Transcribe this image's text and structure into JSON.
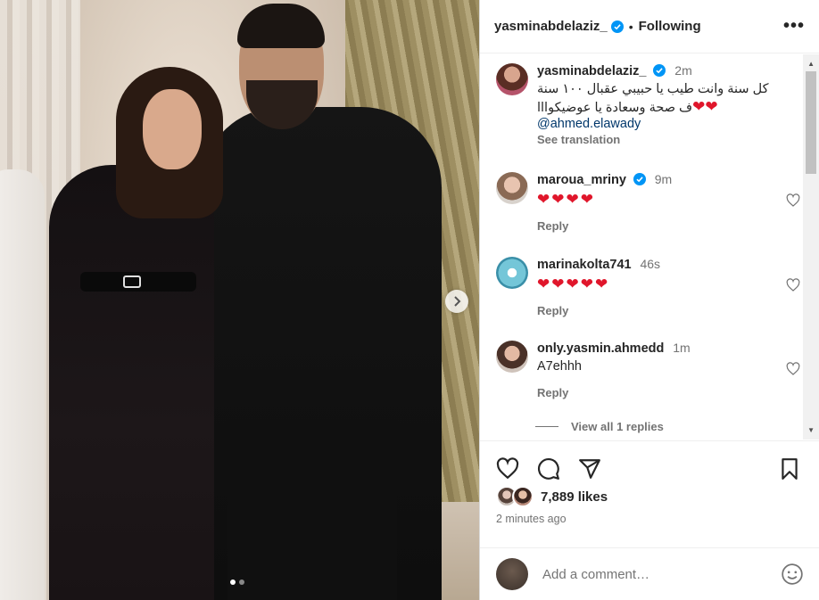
{
  "post": {
    "author": "yasminabdelaziz_",
    "follow_status": "Following",
    "separator": "•",
    "more_icon": "more-horizontal-icon",
    "carousel": {
      "active_index": 0,
      "count": 2
    }
  },
  "caption": {
    "username": "yasminabdelaziz_",
    "time": "2m",
    "line1": "كل سنة وانت طيب يا حبيبي عقبال ١٠٠ سنة",
    "line2_text": "ف صحة وسعادة يا عوضيكوااا",
    "line2_hearts": "❤❤",
    "mention": "@ahmed.elawady",
    "see_translation": "See translation"
  },
  "comments": [
    {
      "username": "maroua_mriny",
      "verified": true,
      "time": "9m",
      "text": "❤❤❤❤",
      "reply_label": "Reply"
    },
    {
      "username": "marinakolta741",
      "verified": false,
      "time": "46s",
      "text": "❤❤❤❤❤",
      "reply_label": "Reply"
    },
    {
      "username": "only.yasmin.ahmedd",
      "verified": false,
      "time": "1m",
      "text": "A7ehhh",
      "reply_label": "Reply"
    }
  ],
  "view_replies": "View all 1 replies",
  "actions": {
    "likes": "7,889 likes",
    "posted_ago": "2 minutes ago"
  },
  "add_comment": {
    "placeholder": "Add a comment…"
  },
  "colors": {
    "verified": "#0095f6",
    "heart_red": "#e0162b",
    "text_primary": "#262626",
    "text_secondary": "#737373",
    "link": "#00376b"
  }
}
